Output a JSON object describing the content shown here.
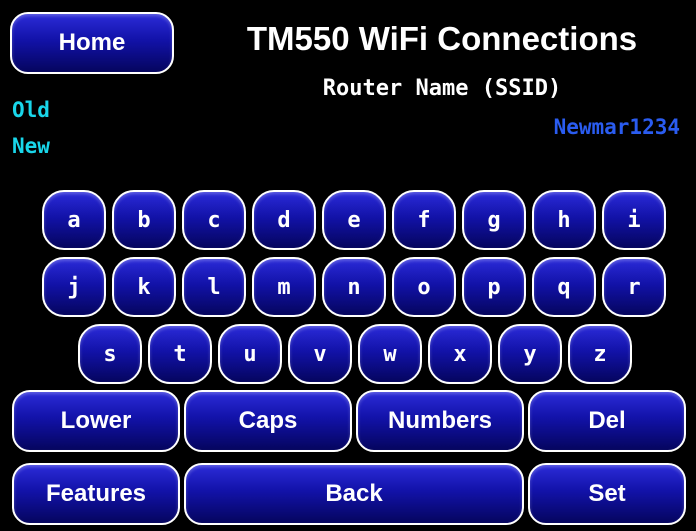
{
  "header": {
    "home_label": "Home",
    "title": "TM550 WiFi Connections",
    "subtitle": "Router Name (SSID)"
  },
  "fields": {
    "old_label": "Old",
    "new_label": "New",
    "old_value": "",
    "new_value": "Newmar1234"
  },
  "keyboard": {
    "row1": [
      "a",
      "b",
      "c",
      "d",
      "e",
      "f",
      "g",
      "h",
      "i"
    ],
    "row2": [
      "j",
      "k",
      "l",
      "m",
      "n",
      "o",
      "p",
      "q",
      "r"
    ],
    "row3": [
      "s",
      "t",
      "u",
      "v",
      "w",
      "x",
      "y",
      "z"
    ]
  },
  "controls": {
    "lower": "Lower",
    "caps": "Caps",
    "numbers": "Numbers",
    "del": "Del",
    "features": "Features",
    "back": "Back",
    "set": "Set"
  },
  "colors": {
    "background": "#000000",
    "button": "#1212a8",
    "label": "#19d6ea",
    "value": "#2a5cf0"
  }
}
